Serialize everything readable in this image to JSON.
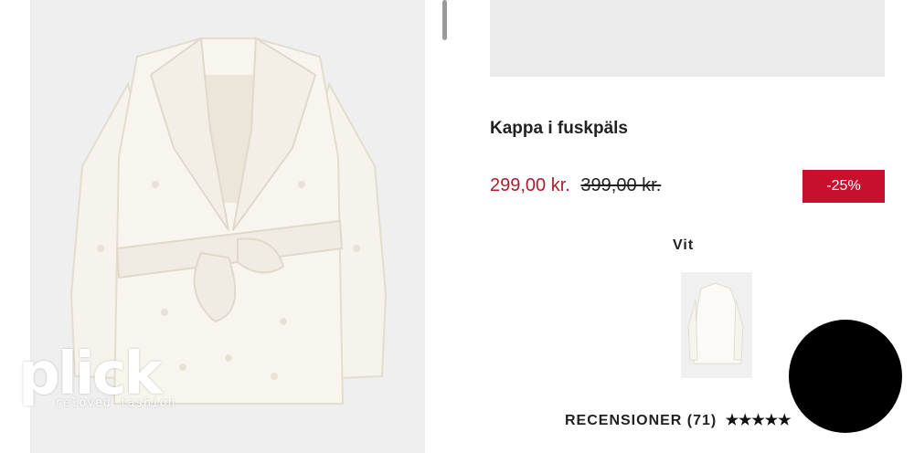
{
  "watermark": {
    "brand": "plick",
    "tagline": "reloved fashion"
  },
  "product": {
    "title": "Kappa i fuskpäls",
    "price_current": "299,00 kr.",
    "price_original": "399,00 kr.",
    "discount": "-25%",
    "color_name": "Vit"
  },
  "reviews": {
    "label": "RECENSIONER (71)",
    "stars": "★★★★★"
  },
  "colors": {
    "sale_price": "#b01c2e",
    "badge_bg": "#c8102e",
    "badge_text": "#ffffff"
  },
  "icons": {
    "chat": "chat-bubble-icon"
  }
}
